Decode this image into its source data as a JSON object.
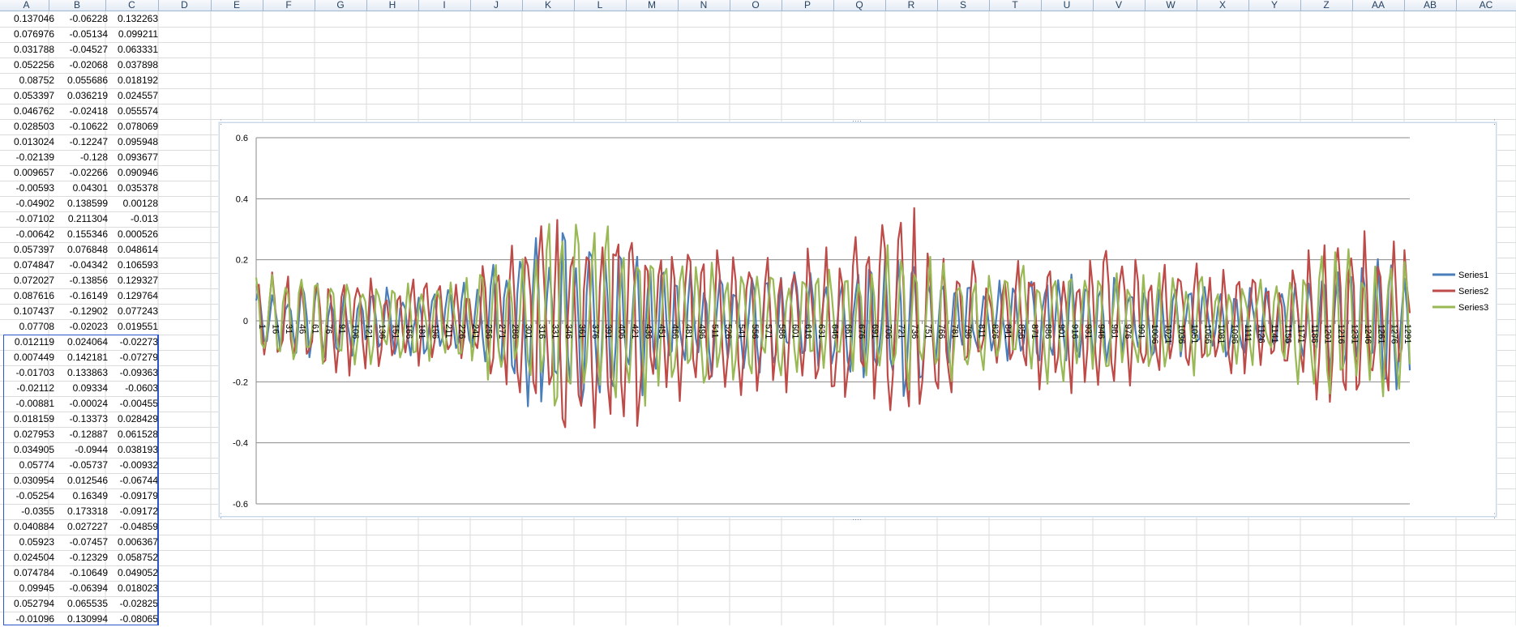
{
  "columns": [
    "A",
    "B",
    "C",
    "D",
    "E",
    "F",
    "G",
    "H",
    "I",
    "J",
    "K",
    "L",
    "M",
    "N",
    "O",
    "P",
    "Q",
    "R",
    "S",
    "T",
    "U",
    "V",
    "W",
    "X",
    "Y",
    "Z",
    "AA",
    "AB",
    "AC"
  ],
  "rows": [
    [
      "0.137046",
      "-0.06228",
      "0.132263"
    ],
    [
      "0.076976",
      "-0.05134",
      "0.099211"
    ],
    [
      "0.031788",
      "-0.04527",
      "0.063331"
    ],
    [
      "0.052256",
      "-0.02068",
      "0.037898"
    ],
    [
      "0.08752",
      "0.055686",
      "0.018192"
    ],
    [
      "0.053397",
      "0.036219",
      "0.024557"
    ],
    [
      "0.046762",
      "-0.02418",
      "0.055574"
    ],
    [
      "0.028503",
      "-0.10622",
      "0.078069"
    ],
    [
      "0.013024",
      "-0.12247",
      "0.095948"
    ],
    [
      "-0.02139",
      "-0.128",
      "0.093677"
    ],
    [
      "0.009657",
      "-0.02266",
      "0.090946"
    ],
    [
      "-0.00593",
      "0.04301",
      "0.035378"
    ],
    [
      "-0.04902",
      "0.138599",
      "0.00128"
    ],
    [
      "-0.07102",
      "0.211304",
      "-0.013"
    ],
    [
      "-0.00642",
      "0.155346",
      "0.000526"
    ],
    [
      "0.057397",
      "0.076848",
      "0.048614"
    ],
    [
      "0.074847",
      "-0.04342",
      "0.106593"
    ],
    [
      "0.072027",
      "-0.13856",
      "0.129327"
    ],
    [
      "0.087616",
      "-0.16149",
      "0.129764"
    ],
    [
      "0.107437",
      "-0.12902",
      "0.077243"
    ],
    [
      "0.07708",
      "-0.02023",
      "0.019551"
    ],
    [
      "0.012119",
      "0.024064",
      "-0.02273"
    ],
    [
      "0.007449",
      "0.142181",
      "-0.07279"
    ],
    [
      "-0.01703",
      "0.133863",
      "-0.09363"
    ],
    [
      "-0.02112",
      "0.09334",
      "-0.0603"
    ],
    [
      "-0.00881",
      "-0.00024",
      "-0.00455"
    ],
    [
      "0.018159",
      "-0.13373",
      "0.028429"
    ],
    [
      "0.027953",
      "-0.12887",
      "0.061528"
    ],
    [
      "0.034905",
      "-0.0944",
      "0.038193"
    ],
    [
      "0.05774",
      "-0.05737",
      "-0.00932"
    ],
    [
      "0.030954",
      "0.012546",
      "-0.06744"
    ],
    [
      "-0.05254",
      "0.16349",
      "-0.09179"
    ],
    [
      "-0.0355",
      "0.173318",
      "-0.09172"
    ],
    [
      "0.040884",
      "0.027227",
      "-0.04859"
    ],
    [
      "0.05923",
      "-0.07457",
      "0.006367"
    ],
    [
      "0.024504",
      "-0.12329",
      "0.058752"
    ],
    [
      "0.074784",
      "-0.10649",
      "0.049052"
    ],
    [
      "0.09945",
      "-0.06394",
      "0.018023"
    ],
    [
      "0.052794",
      "0.065535",
      "-0.02825"
    ],
    [
      "-0.01096",
      "0.130994",
      "-0.08065"
    ]
  ],
  "chart_data": {
    "type": "line",
    "ylim": [
      -0.6,
      0.6
    ],
    "yticks": [
      "0.6",
      "0.4",
      "0.2",
      "0",
      "-0.2",
      "-0.4",
      "-0.6"
    ],
    "x_tick_labels": [
      "1",
      "16",
      "31",
      "46",
      "61",
      "76",
      "91",
      "106",
      "121",
      "136",
      "151",
      "166",
      "181",
      "196",
      "211",
      "226",
      "241",
      "256",
      "271",
      "286",
      "301",
      "316",
      "331",
      "346",
      "361",
      "376",
      "391",
      "406",
      "421",
      "436",
      "451",
      "466",
      "481",
      "496",
      "511",
      "526",
      "541",
      "556",
      "571",
      "586",
      "601",
      "616",
      "631",
      "646",
      "661",
      "676",
      "691",
      "706",
      "721",
      "736",
      "751",
      "766",
      "781",
      "796",
      "811",
      "826",
      "841",
      "856",
      "871",
      "886",
      "901",
      "916",
      "931",
      "946",
      "961",
      "976",
      "991",
      "1006",
      "1021",
      "1036",
      "1051",
      "1066",
      "1081",
      "1096",
      "1111",
      "1126",
      "1141",
      "1156",
      "1171",
      "1186",
      "1201",
      "1216",
      "1231",
      "1246",
      "1261",
      "1276",
      "1291"
    ],
    "n_points": 1300,
    "series": [
      {
        "name": "Series1",
        "color": "#4a7ebb",
        "amplitude_envelope": [
          0.12,
          0.13,
          0.12,
          0.14,
          0.35,
          0.3,
          0.2,
          0.18,
          0.15,
          0.3,
          0.12,
          0.18,
          0.15,
          0.14,
          0.12,
          0.2,
          0.25
        ]
      },
      {
        "name": "Series2",
        "color": "#be4b48",
        "amplitude_envelope": [
          0.18,
          0.2,
          0.16,
          0.15,
          0.45,
          0.42,
          0.3,
          0.28,
          0.32,
          0.42,
          0.2,
          0.25,
          0.28,
          0.2,
          0.18,
          0.33,
          0.3
        ]
      },
      {
        "name": "Series3",
        "color": "#98b954",
        "amplitude_envelope": [
          0.15,
          0.17,
          0.14,
          0.16,
          0.38,
          0.34,
          0.24,
          0.22,
          0.2,
          0.28,
          0.2,
          0.22,
          0.2,
          0.18,
          0.15,
          0.3,
          0.26
        ]
      }
    ],
    "legend_position": "right",
    "grid": true
  }
}
